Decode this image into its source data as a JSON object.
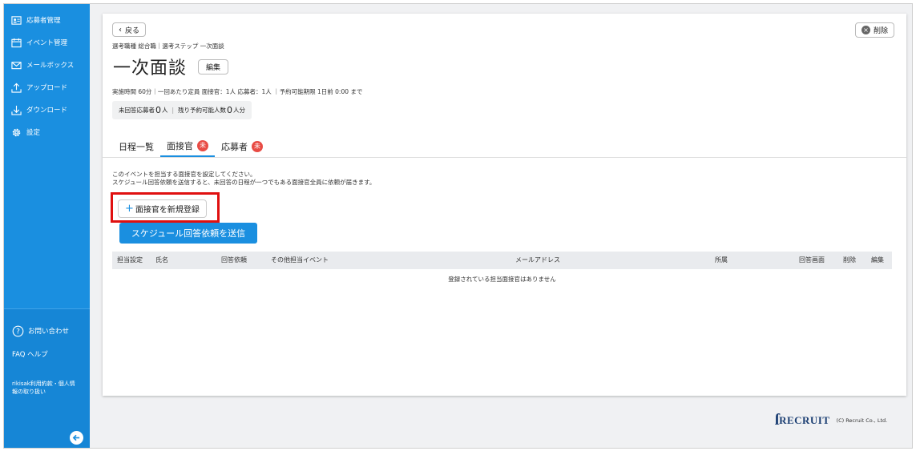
{
  "sidebar": {
    "items": [
      {
        "label": "応募者管理",
        "icon": "user-card-icon"
      },
      {
        "label": "イベント管理",
        "icon": "calendar-icon"
      },
      {
        "label": "メールボックス",
        "icon": "mail-icon"
      },
      {
        "label": "アップロード",
        "icon": "upload-icon"
      },
      {
        "label": "ダウンロード",
        "icon": "download-icon"
      },
      {
        "label": "設定",
        "icon": "gear-icon"
      }
    ],
    "help_label": "お問い合わせ",
    "faq_label": "FAQ ヘルプ",
    "terms_label": "rikisak利用約款・個人情報の取り扱い"
  },
  "header": {
    "back_label": "戻る",
    "delete_label": "削除",
    "breadcrumb": "選考職種 総合職｜選考ステップ 一次面談",
    "title": "一次面談",
    "edit_label": "編集",
    "meta": "実施時間 60分｜一回あたり定員 面接官：1人 応募者：1人 ｜予約可能期限 1日前 0:00 まで",
    "unanswered_label": "未回答応募者",
    "unanswered_count": "0",
    "unanswered_unit": "人",
    "remaining_label": "残り予約可能人数",
    "remaining_count": "0",
    "remaining_unit": "人分"
  },
  "tabs": [
    {
      "label": "日程一覧",
      "badge": ""
    },
    {
      "label": "面接官",
      "badge": "未"
    },
    {
      "label": "応募者",
      "badge": "未"
    }
  ],
  "interviewers": {
    "desc_line1": "このイベントを担当する面接官を設定してください。",
    "desc_line2": "スケジュール回答依頼を送信すると、未回答の日程が一つでもある面接官全員に依頼が届きます。",
    "new_button_label": "面接官を新規登録",
    "send_button_label": "スケジュール回答依頼を送信",
    "columns": [
      "担当設定",
      "氏名",
      "回答依頼",
      "その他担当イベント",
      "メールアドレス",
      "所属",
      "回答画面",
      "削除",
      "編集"
    ],
    "empty_message": "登録されている担当面接官はありません"
  },
  "footer": {
    "logo_text": "RECRUIT",
    "copyright": "(C) Recruit Co., Ltd."
  },
  "colors": {
    "accent": "#1a8fe0",
    "badge": "#e84b44",
    "highlight": "#e01010"
  }
}
